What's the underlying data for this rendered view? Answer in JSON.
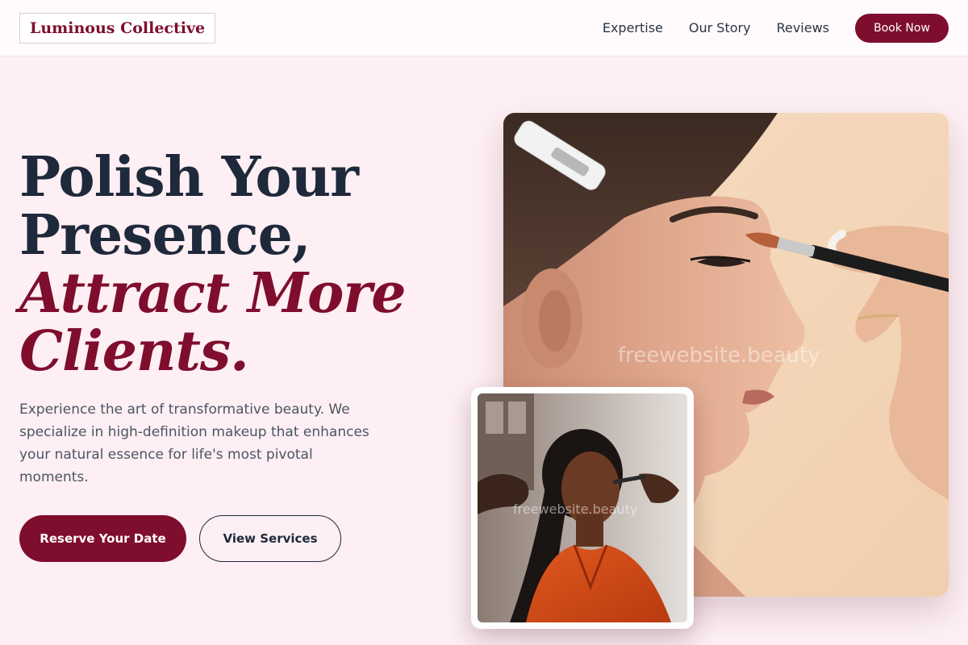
{
  "header": {
    "logo": "Luminous Collective",
    "nav": [
      "Expertise",
      "Our Story",
      "Reviews"
    ],
    "cta": "Book Now"
  },
  "hero": {
    "title_line1": "Polish Your",
    "title_line2": "Presence,",
    "accent_line1": "Attract More",
    "accent_line2": "Clients.",
    "description": "Experience the art of transformative beauty. We specialize in high-definition makeup that enhances your natural essence for life's most pivotal moments.",
    "primary_button": "Reserve Your Date",
    "secondary_button": "View Services"
  },
  "images": {
    "main_watermark": "freewebsite.beauty",
    "small_watermark": "freewebsite.beauty"
  },
  "colors": {
    "brand": "#7f0d2e",
    "background": "#fdeff3",
    "heading": "#1e293b"
  }
}
